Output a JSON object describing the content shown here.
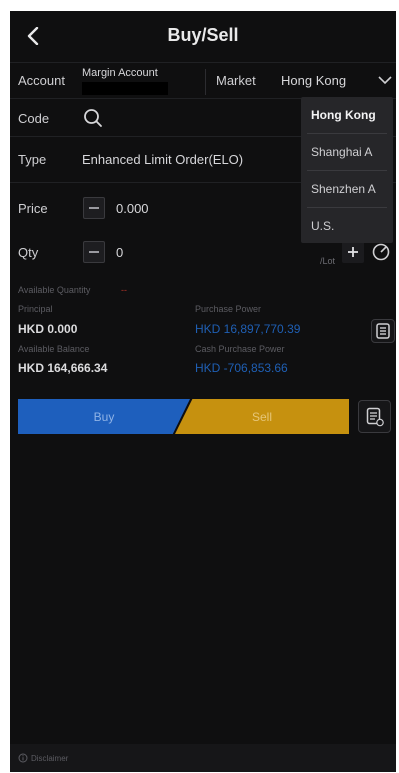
{
  "header": {
    "title": "Buy/Sell"
  },
  "account": {
    "label": "Account",
    "value": "Margin Account"
  },
  "market": {
    "label": "Market",
    "value": "Hong Kong"
  },
  "code": {
    "label": "Code"
  },
  "type": {
    "label": "Type",
    "value": "Enhanced Limit Order(ELO)"
  },
  "price": {
    "label": "Price",
    "value": "0.000"
  },
  "qty": {
    "label": "Qty",
    "value": "0",
    "unit": "/Lot"
  },
  "summary": {
    "available_quantity_label": "Available Quantity",
    "available_quantity_value": "--",
    "principal_label": "Principal",
    "principal_value": "HKD 0.000",
    "purchase_power_label": "Purchase Power",
    "purchase_power_value": "HKD 16,897,770.39",
    "available_balance_label": "Available Balance",
    "available_balance_value": "HKD 164,666.34",
    "cash_purchase_power_label": "Cash Purchase Power",
    "cash_purchase_power_value": "HKD -706,853.66"
  },
  "actions": {
    "buy_label": "Buy",
    "sell_label": "Sell"
  },
  "market_dropdown": {
    "items": [
      "Hong Kong",
      "Shanghai A",
      "Shenzhen A",
      "U.S."
    ],
    "selected": "Hong Kong"
  },
  "footer": {
    "disclaimer_label": "Disclaimer"
  },
  "colors": {
    "buy": "#1e5fbd",
    "sell": "#c6910f",
    "link_blue": "#1f5fb4",
    "background": "#0f0f10"
  }
}
